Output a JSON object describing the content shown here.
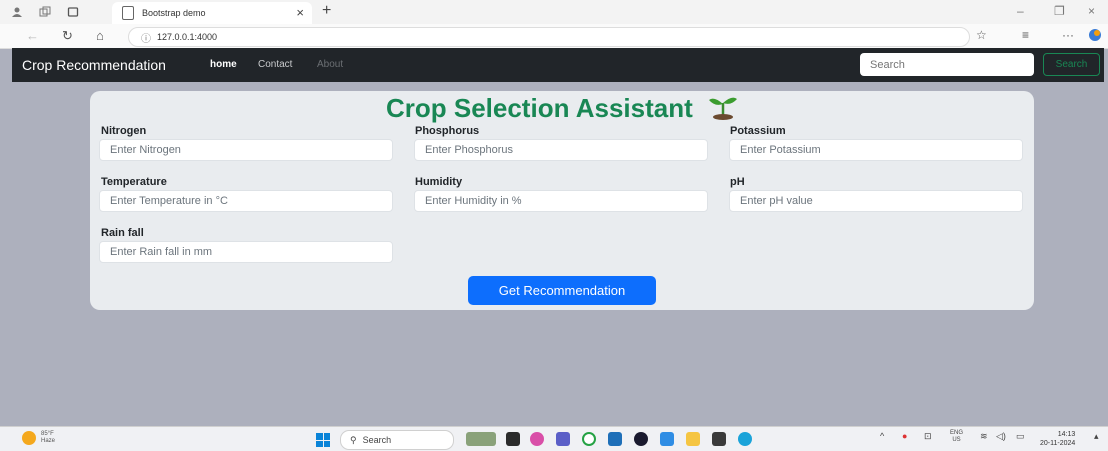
{
  "browser": {
    "tab_title": "Bootstrap demo",
    "tab_close": "×",
    "new_tab": "+",
    "url": "127.0.0.1:4000",
    "win_minimize": "–",
    "win_restore": "❐",
    "win_close": "×"
  },
  "navbar": {
    "brand": "Crop Recommendation",
    "links": [
      "home",
      "Contact",
      "About"
    ],
    "search_placeholder": "Search",
    "search_button": "Search"
  },
  "form": {
    "title": "Crop Selection Assistant",
    "fields": [
      {
        "label": "Nitrogen",
        "placeholder": "Enter Nitrogen"
      },
      {
        "label": "Phosphorus",
        "placeholder": "Enter Phosphorus"
      },
      {
        "label": "Potassium",
        "placeholder": "Enter Potassium"
      },
      {
        "label": "Temperature",
        "placeholder": "Enter Temperature in °C"
      },
      {
        "label": "Humidity",
        "placeholder": "Enter Humidity in %"
      },
      {
        "label": "pH",
        "placeholder": "Enter pH value"
      },
      {
        "label": "Rain fall",
        "placeholder": "Enter Rain fall in mm"
      }
    ],
    "submit": "Get Recommendation"
  },
  "taskbar": {
    "weather_temp": "85°F",
    "weather_cond": "Haze",
    "search": "Search",
    "lang": "ENG",
    "region": "US",
    "time": "14:13",
    "date": "20-11-2024"
  },
  "colors": {
    "accent_green": "#198754",
    "primary_blue": "#0d6efd",
    "navbar_dark": "#212529"
  }
}
